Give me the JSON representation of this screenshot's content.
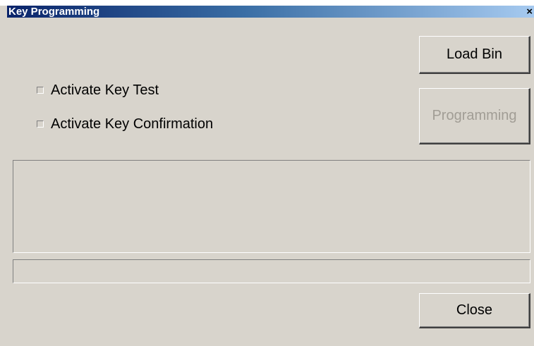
{
  "window": {
    "title": "Key Programming",
    "close_glyph": "×"
  },
  "buttons": {
    "load_bin": "Load Bin",
    "programming": "Programming",
    "close": "Close"
  },
  "checkboxes": [
    {
      "label": "Activate Key Test",
      "checked": false
    },
    {
      "label": "Activate Key Confirmation",
      "checked": false
    }
  ],
  "status": {
    "message": "",
    "progress": 0
  },
  "colors": {
    "dialog_bg": "#d8d4cc",
    "titlebar_start": "#0a246a",
    "titlebar_end": "#a6caf0",
    "disabled_text": "#a19d95"
  },
  "icons": {
    "close": "close-icon",
    "checkbox": "checkbox-icon"
  }
}
